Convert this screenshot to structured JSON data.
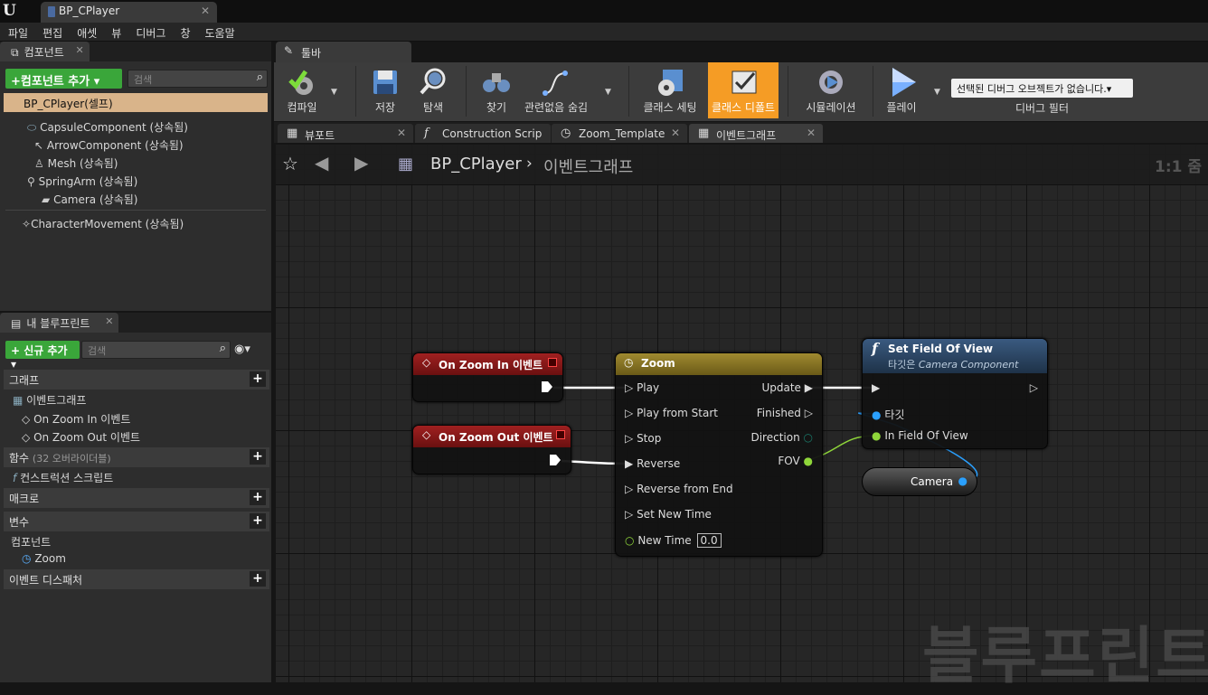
{
  "window": {
    "tab_title": "BP_CPlayer"
  },
  "menu": [
    "파일",
    "편집",
    "애셋",
    "뷰",
    "디버그",
    "창",
    "도움말"
  ],
  "components_panel": {
    "title": "컴포넌트",
    "add_button": "+컴포넌트 추가",
    "search_placeholder": "검색",
    "root": "BP_CPlayer(셀프)",
    "items": [
      "CapsuleComponent (상속됨)",
      "ArrowComponent (상속됨)",
      "Mesh (상속됨)",
      "SpringArm (상속됨)",
      "Camera (상속됨)",
      "CharacterMovement (상속됨)"
    ]
  },
  "my_blueprint": {
    "title": "내 블루프린트",
    "new_button": "+ 신규 추가",
    "search_placeholder": "검색",
    "graph_section": "그래프",
    "event_graph": "이벤트그래프",
    "events": [
      "On Zoom In 이벤트",
      "On Zoom Out 이벤트"
    ],
    "functions_section": "함수",
    "functions_override": "(32 오버라이더블)",
    "construction_script": "컨스트럭션 스크립트",
    "macros_section": "매크로",
    "variables_section": "변수",
    "components_category": "컴포넌트",
    "zoom_var": "Zoom",
    "dispatchers_section": "이벤트 디스패처"
  },
  "toolbar": {
    "tab": "툴바",
    "buttons": [
      "컴파일",
      "저장",
      "탐색",
      "찾기",
      "관련없음 숨김",
      "클래스 세팅",
      "클래스 디폴트",
      "시뮬레이션",
      "플레이"
    ],
    "debug_select": "선택된 디버그 오브젝트가 없습니다.",
    "debug_filter": "디버그 필터"
  },
  "editor_tabs": [
    "뷰포트",
    "Construction Scrip",
    "Zoom_Template",
    "이벤트그래프"
  ],
  "breadcrumb": {
    "blueprint": "BP_CPlayer",
    "graph": "이벤트그래프",
    "zoom": "1:1 줌"
  },
  "watermark": "블루프린트",
  "nodes": {
    "zoom_in": {
      "title": "On Zoom In 이벤트"
    },
    "zoom_out": {
      "title": "On Zoom Out 이벤트"
    },
    "timeline": {
      "title": "Zoom",
      "inputs": [
        "Play",
        "Play from Start",
        "Stop",
        "Reverse",
        "Reverse from End",
        "Set New Time",
        "New Time"
      ],
      "outputs": [
        "Update",
        "Finished",
        "Direction",
        "FOV"
      ],
      "new_time_value": "0.0"
    },
    "set_fov": {
      "title": "Set Field Of View",
      "subtitle_prefix": "타깃은 ",
      "subtitle_target": "Camera Component",
      "pins": [
        "타깃",
        "In Field Of View"
      ]
    },
    "camera": {
      "label": "Camera"
    }
  },
  "colors": {
    "accent_orange": "#f59c25",
    "event_red": "#8a1a1a",
    "timeline_gold": "#8f7a2a",
    "function_blue": "#2a4a6a",
    "float_green": "#8fd63a",
    "object_blue": "#2aa0ff"
  }
}
